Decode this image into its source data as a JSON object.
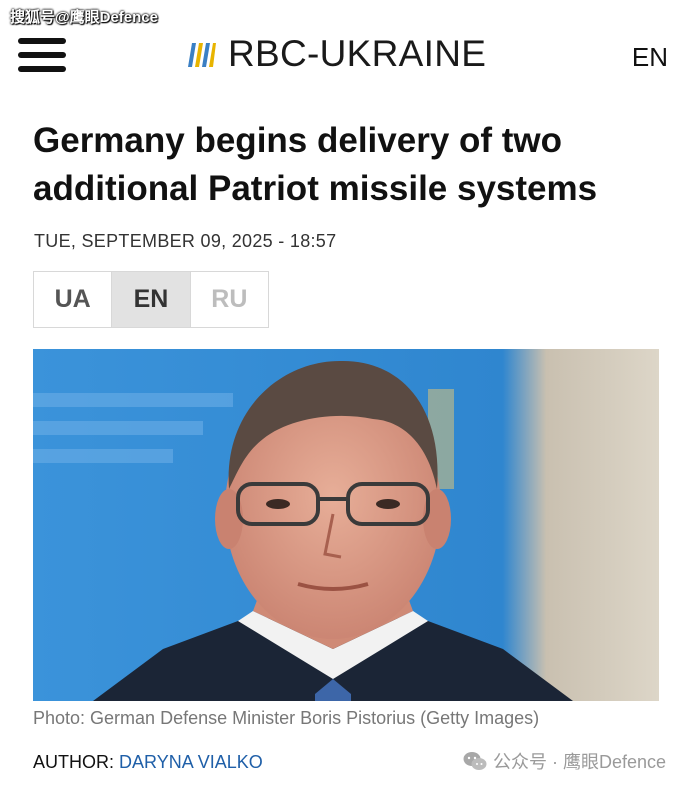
{
  "watermark_top": "搜狐号@鹰眼Defence",
  "header": {
    "logo_text": "RBC-UKRAINE",
    "language_link": "EN",
    "menu_icon": "hamburger-menu-icon",
    "logo_icon": "rbc-logo-icon"
  },
  "article": {
    "title": "Germany begins delivery of two additional Patriot missile systems",
    "date": "TUE, SEPTEMBER 09, 2025 - 18:57",
    "languages": [
      {
        "label": "UA",
        "active": false
      },
      {
        "label": "EN",
        "active": true
      },
      {
        "label": "RU",
        "active": false
      }
    ],
    "photo_caption": "Photo: German Defense Minister Boris Pistorius (Getty Images)",
    "author_label": "AUTHOR:",
    "author_name": "DARYNA VIALKO"
  },
  "watermark_bottom": {
    "icon": "wechat-icon",
    "text": "公众号 · 鹰眼Defence"
  },
  "colors": {
    "author_link": "#1f5fa8",
    "photo_background": "#3d8fd4",
    "active_language_bg": "#e2e2e2"
  }
}
